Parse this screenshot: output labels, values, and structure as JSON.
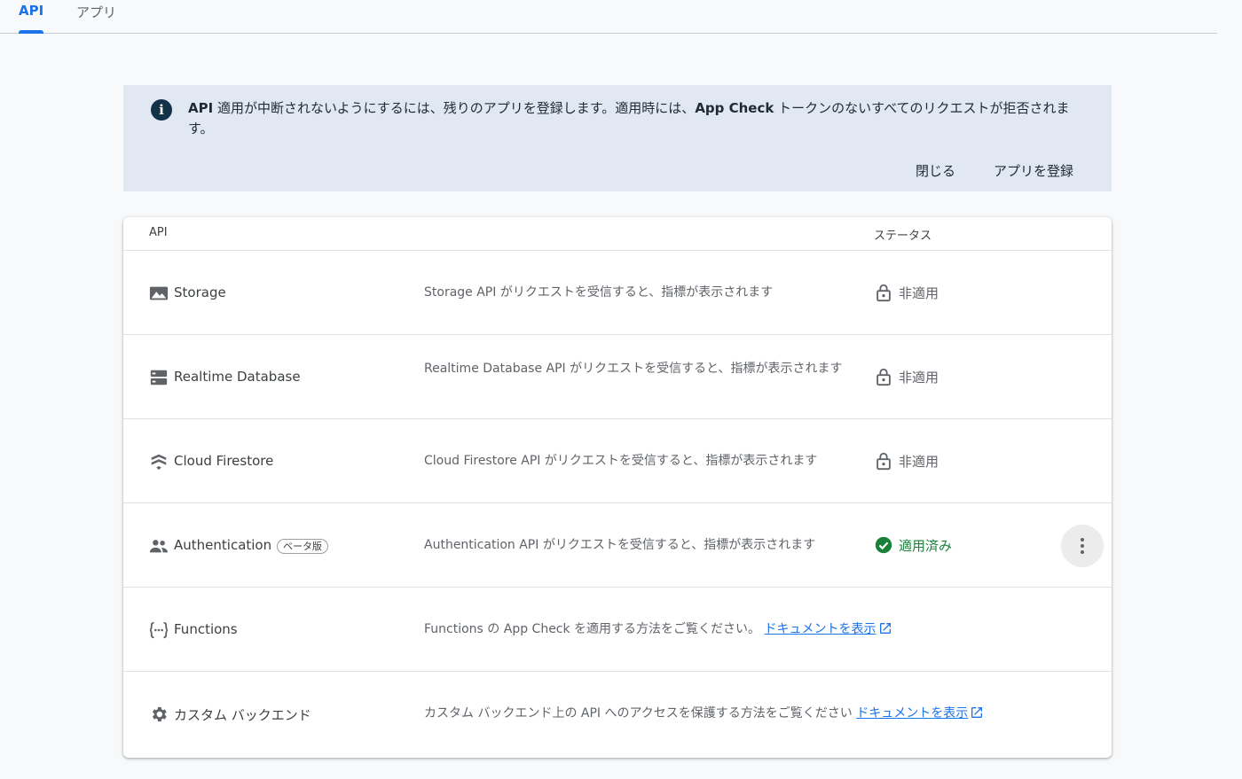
{
  "tabs": [
    {
      "label": "API"
    },
    {
      "label": "アプリ"
    }
  ],
  "banner": {
    "message_parts": [
      "API",
      " 適用が中断されないようにするには、残りのアプリを登録します。適用時には、",
      "App Check",
      " トークンのないすべてのリクエストが拒否されます。"
    ],
    "close_label": "閉じる",
    "register_label": "アプリを登録"
  },
  "table": {
    "header_api": "API",
    "header_status": "ステータス",
    "rows": [
      {
        "name": "Storage",
        "icon": "image-icon",
        "description": "Storage API がリクエストを受信すると、指標が表示されます",
        "status": "非適用",
        "status_icon": "lock-open-icon"
      },
      {
        "name": "Realtime Database",
        "icon": "database-icon",
        "description": "Realtime Database API がリクエストを受信すると、指標が表示されます",
        "status": "非適用",
        "status_icon": "lock-open-icon"
      },
      {
        "name": "Cloud Firestore",
        "icon": "firestore-icon",
        "description": "Cloud Firestore API がリクエストを受信すると、指標が表示されます",
        "status": "非適用",
        "status_icon": "lock-open-icon"
      },
      {
        "name": "Authentication",
        "icon": "people-icon",
        "badge": "ベータ版",
        "description": "Authentication API がリクエストを受信すると、指標が表示されます",
        "status": "適用済み",
        "status_icon": "check-circle-icon"
      },
      {
        "name": "Functions",
        "icon": "functions-icon",
        "description": "Functions の App Check を適用する方法をご覧ください。",
        "link": "ドキュメントを表示"
      },
      {
        "name": "カスタム バックエンド",
        "icon": "gear-icon",
        "description": "カスタム バックエンド上の API へのアクセスを保護する方法をご覧ください",
        "link": "ドキュメントを表示"
      }
    ]
  },
  "colors": {
    "accent": "#1a73e8",
    "success": "#188038",
    "banner_bg": "#e1e8f1"
  }
}
